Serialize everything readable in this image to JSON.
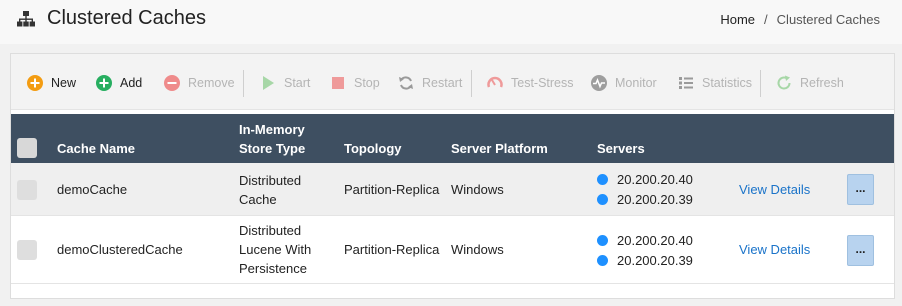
{
  "header": {
    "title": "Clustered Caches",
    "title_icon": "sitemap-icon"
  },
  "breadcrumb": {
    "home": "Home",
    "separator": "/",
    "current": "Clustered Caches"
  },
  "toolbar": {
    "new": "New",
    "add": "Add",
    "remove": "Remove",
    "start": "Start",
    "stop": "Stop",
    "restart": "Restart",
    "test_stress": "Test-Stress",
    "monitor": "Monitor",
    "statistics": "Statistics",
    "refresh": "Refresh"
  },
  "table": {
    "headers": {
      "cache_name": "Cache Name",
      "store_type_line1": "In-Memory",
      "store_type_line2": "Store Type",
      "topology": "Topology",
      "platform": "Server Platform",
      "servers": "Servers"
    },
    "rows": [
      {
        "name": "demoCache",
        "store_type": [
          "Distributed",
          "Cache"
        ],
        "topology": "Partition-Replica",
        "platform": "Windows",
        "servers": [
          "20.200.20.40",
          "20.200.20.39"
        ],
        "details_label": "View Details",
        "more_label": "..."
      },
      {
        "name": "demoClusteredCache",
        "store_type": [
          "Distributed",
          "Lucene With",
          "Persistence"
        ],
        "topology": "Partition-Replica",
        "platform": "Windows",
        "servers": [
          "20.200.20.40",
          "20.200.20.39"
        ],
        "details_label": "View Details",
        "more_label": "..."
      }
    ]
  },
  "colors": {
    "table_header_bg": "#3e4f61",
    "link": "#1a73c9",
    "server_dot": "#1e90ff",
    "new_icon": "#f39c12",
    "add_icon": "#27ae60",
    "remove_icon": "#e05a5a"
  }
}
